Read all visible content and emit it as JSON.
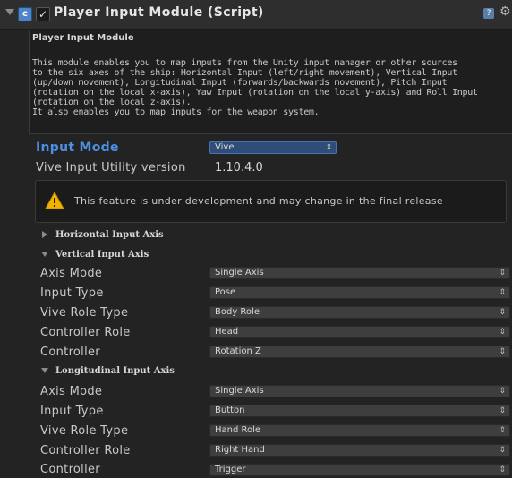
{
  "header": {
    "title": "Player Input Module (Script)",
    "enabled_check": "✓",
    "script_icon_glyph": "c",
    "help_glyph": "?",
    "gear_glyph": "⚙"
  },
  "description": {
    "title": "Player Input Module",
    "text": "This module enables you to map inputs from the Unity input manager or other sources\nto the six axes of the ship: Horizontal Input (left/right movement), Vertical Input\n(up/down movement), Longitudinal Input (forwards/backwards movement), Pitch Input\n(rotation on the local x-axis), Yaw Input (rotation on the local y-axis) and Roll Input\n(rotation on the local z-axis).\nIt also enables you to map inputs for the weapon system."
  },
  "input_mode": {
    "label": "Input Mode",
    "value": "Vive"
  },
  "vive_version": {
    "label": "Vive Input Utility version",
    "value": "1.10.4.0"
  },
  "warning": {
    "text": "This feature is under development and may change in the final release"
  },
  "horizontal": {
    "title": "Horizontal Input Axis"
  },
  "vertical": {
    "title": "Vertical Input Axis",
    "fields": [
      {
        "label": "Axis Mode",
        "value": "Single Axis"
      },
      {
        "label": "Input Type",
        "value": "Pose"
      },
      {
        "label": "Vive Role Type",
        "value": "Body Role"
      },
      {
        "label": "Controller Role",
        "value": "Head"
      },
      {
        "label": "Controller",
        "value": "Rotation Z"
      }
    ]
  },
  "longitudinal": {
    "title": "Longitudinal Input Axis",
    "fields": [
      {
        "label": "Axis Mode",
        "value": "Single Axis"
      },
      {
        "label": "Input Type",
        "value": "Button"
      },
      {
        "label": "Vive Role Type",
        "value": "Hand Role"
      },
      {
        "label": "Controller Role",
        "value": "Right Hand"
      },
      {
        "label": "Controller",
        "value": "Trigger"
      }
    ]
  },
  "dropdown_arrow": "⇕"
}
